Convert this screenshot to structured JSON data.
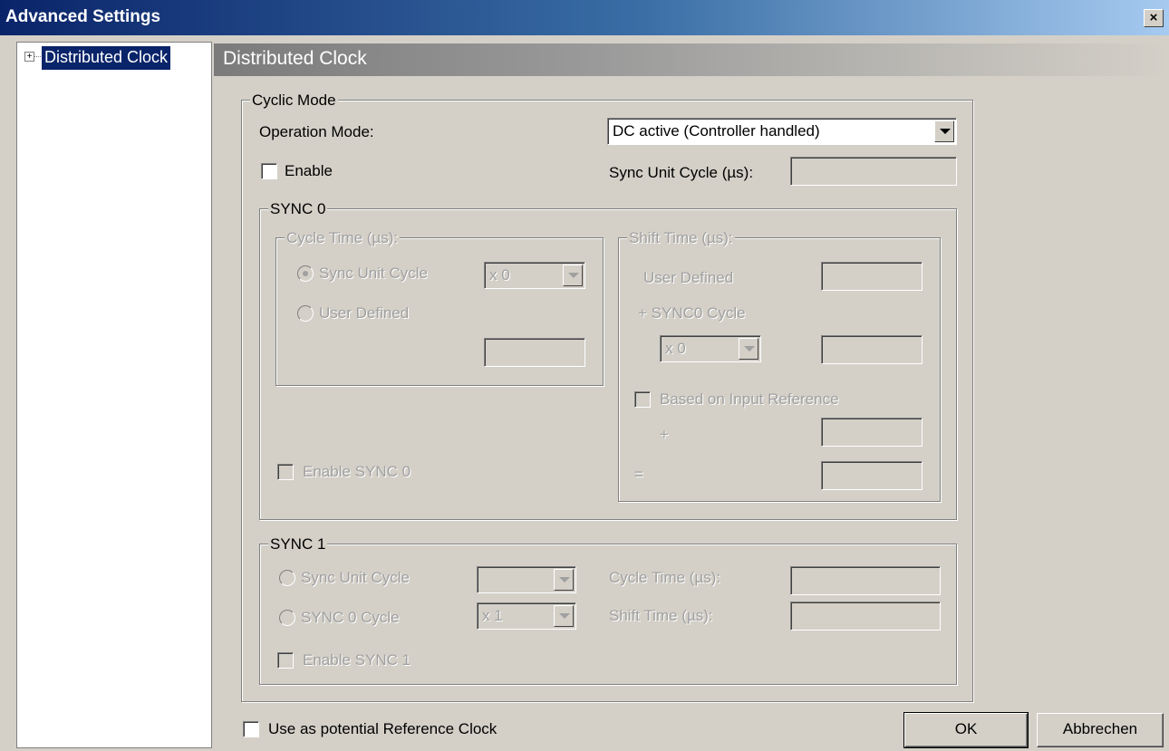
{
  "window": {
    "title": "Advanced Settings",
    "close_label": "×"
  },
  "tree": {
    "expander": "+",
    "items": [
      {
        "label": "Distributed Clock"
      }
    ]
  },
  "panel": {
    "title": "Distributed Clock"
  },
  "cyclic_mode": {
    "legend": "Cyclic Mode",
    "operation_mode_label": "Operation Mode:",
    "operation_mode_value": "DC active (Controller handled)",
    "enable_label": "Enable",
    "sync_unit_cycle_label": "Sync Unit Cycle (µs):",
    "sync_unit_cycle_value": ""
  },
  "sync0": {
    "legend": "SYNC 0",
    "cycle_time_legend": "Cycle Time (µs):",
    "sync_unit_cycle_label": "Sync Unit Cycle",
    "sync_unit_cycle_factor": "x 0",
    "user_defined_label": "User Defined",
    "user_defined_value": "",
    "shift_time_legend": "Shift Time (µs):",
    "shift_user_defined_label": "User Defined",
    "shift_user_defined_value": "",
    "sync0_cycle_label": "+ SYNC0 Cycle",
    "sync0_cycle_factor": "x 0",
    "sync0_cycle_value": "",
    "based_on_input_label": "Based on Input Reference",
    "plus_sign": "+",
    "plus_value": "",
    "equals_sign": "=",
    "equals_value": "",
    "enable_label": "Enable SYNC 0"
  },
  "sync1": {
    "legend": "SYNC 1",
    "sync_unit_cycle_label": "Sync Unit Cycle",
    "sync_unit_cycle_factor": "",
    "sync0_cycle_label": "SYNC 0 Cycle",
    "sync0_cycle_factor": "x 1",
    "cycle_time_label": "Cycle Time (µs):",
    "cycle_time_value": "",
    "shift_time_label": "Shift Time (µs):",
    "shift_time_value": "",
    "enable_label": "Enable SYNC 1"
  },
  "footer": {
    "reference_clock_label": "Use as potential Reference Clock",
    "ok_label": "OK",
    "cancel_label": "Abbrechen"
  }
}
